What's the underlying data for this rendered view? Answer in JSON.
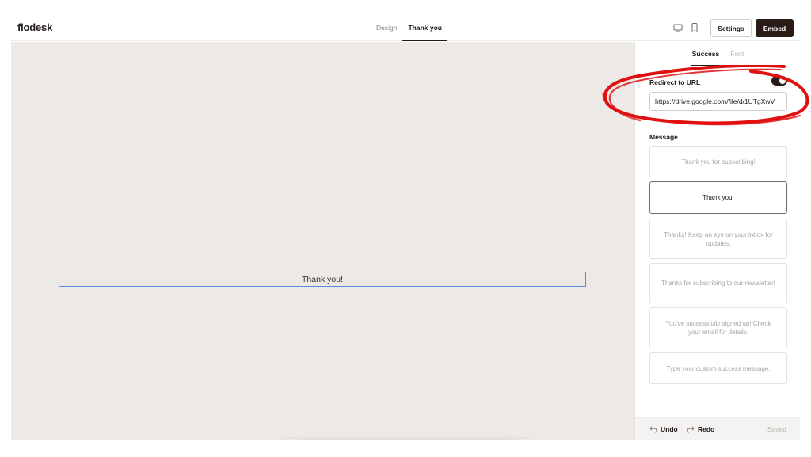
{
  "app": {
    "logo": "flodesk"
  },
  "header": {
    "tabs": [
      {
        "label": "Design",
        "active": false
      },
      {
        "label": "Thank you",
        "active": true
      }
    ],
    "device_icons": [
      "desktop-icon",
      "mobile-icon"
    ],
    "settings_label": "Settings",
    "embed_label": "Embed"
  },
  "canvas": {
    "thank_you_text": "Thank you!"
  },
  "panel": {
    "tabs": [
      {
        "label": "Success",
        "active": true
      },
      {
        "label": "Font",
        "active": false
      }
    ],
    "redirect": {
      "label": "Redirect to URL",
      "enabled": true,
      "url": "https://drive.google.com/file/d/1UTgXwV"
    },
    "message": {
      "label": "Message",
      "options": [
        {
          "text": "Thank you for subscribing!",
          "selected": false
        },
        {
          "text": "Thank you!",
          "selected": true
        },
        {
          "text": "Thanks! Keep an eye on your inbox for updates.",
          "selected": false
        },
        {
          "text": "Thanks for subscribing to our newsletter!",
          "selected": false
        },
        {
          "text": "You've successfully signed up! Check your email for details.",
          "selected": false
        },
        {
          "text": "Type your custom success message.",
          "selected": false
        }
      ]
    },
    "footer": {
      "undo_label": "Undo",
      "redo_label": "Redo",
      "status": "Saved"
    }
  },
  "colors": {
    "accent_dark": "#2a1b17",
    "canvas_bg": "#ece9e6",
    "selection_blue": "#5b8bd6",
    "annotation_red": "#e01010"
  }
}
